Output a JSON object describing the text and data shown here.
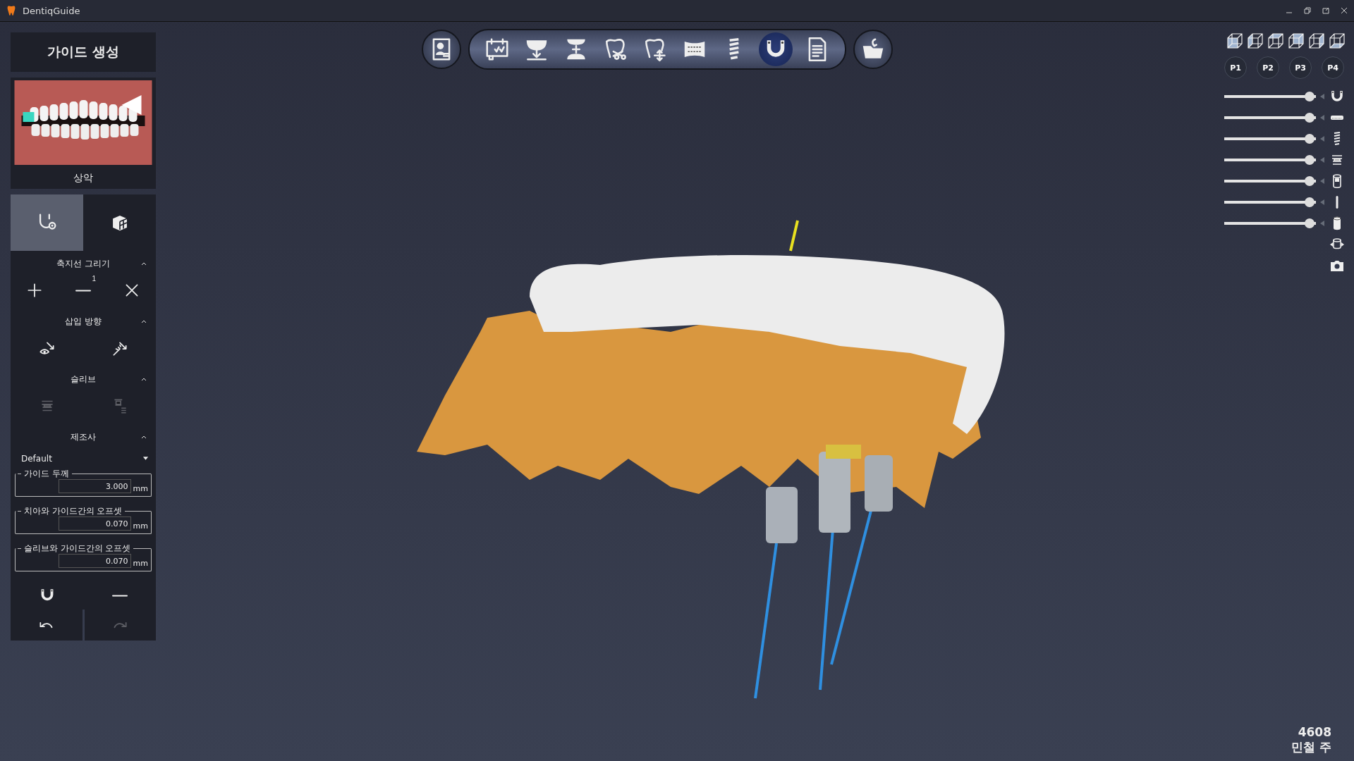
{
  "window": {
    "title": "DentiqGuide"
  },
  "panel": {
    "title": "가이드 생성",
    "arch_label": "상악"
  },
  "mode_tabs": [
    {
      "kind": "guide",
      "selected": true
    },
    {
      "kind": "model",
      "selected": false
    }
  ],
  "sections": [
    {
      "title": "축지선 그리기",
      "expanded": true,
      "tools": [
        {
          "kind": "plus",
          "disabled": false
        },
        {
          "kind": "minus",
          "disabled": false,
          "count": "1"
        },
        {
          "kind": "close",
          "disabled": false
        }
      ]
    },
    {
      "title": "삽입 방향",
      "expanded": true,
      "tools": [
        {
          "kind": "eye-arrow",
          "disabled": false
        },
        {
          "kind": "wand-arrow",
          "disabled": false
        }
      ]
    },
    {
      "title": "슬리브",
      "expanded": true,
      "tools": [
        {
          "kind": "sleeve",
          "disabled": true
        },
        {
          "kind": "sleeve-offset",
          "disabled": true
        }
      ]
    },
    {
      "title": "제조사",
      "expanded": true
    }
  ],
  "manufacturer": {
    "value": "Default"
  },
  "fields": [
    {
      "label": "가이드 두께",
      "value": "3.000",
      "unit": "mm"
    },
    {
      "label": "치아와 가이드간의 오프셋",
      "value": "0.070",
      "unit": "mm"
    },
    {
      "label": "슬리브와 가이드간의 오프셋",
      "value": "0.070",
      "unit": "mm"
    }
  ],
  "bottom_tools": [
    {
      "kind": "guide"
    },
    {
      "kind": "minus"
    }
  ],
  "history": [
    {
      "kind": "undo",
      "disabled": false
    },
    {
      "kind": "redo",
      "disabled": true
    }
  ],
  "toolbar": {
    "left": {
      "kind": "patient"
    },
    "items": [
      {
        "kind": "plan",
        "selected": false
      },
      {
        "kind": "import",
        "selected": false
      },
      {
        "kind": "jaws",
        "selected": false
      },
      {
        "kind": "cut",
        "selected": false
      },
      {
        "kind": "move",
        "selected": false
      },
      {
        "kind": "panorama",
        "selected": false
      },
      {
        "kind": "implant",
        "selected": false
      },
      {
        "kind": "guide",
        "selected": true
      },
      {
        "kind": "report",
        "selected": false
      }
    ],
    "right": {
      "kind": "folder"
    }
  },
  "view_buttons": [
    {
      "kind": "front"
    },
    {
      "kind": "left"
    },
    {
      "kind": "top"
    },
    {
      "kind": "back"
    },
    {
      "kind": "right"
    },
    {
      "kind": "bottom"
    }
  ],
  "presets": [
    "P1",
    "P2",
    "P3",
    "P4"
  ],
  "layers": [
    {
      "kind": "guide",
      "level": 0.98
    },
    {
      "kind": "teeth",
      "level": 0.98
    },
    {
      "kind": "implant",
      "level": 0.98
    },
    {
      "kind": "sleeve",
      "level": 0.98
    },
    {
      "kind": "cylinder",
      "level": 0.98
    },
    {
      "kind": "pin",
      "level": 0.98
    },
    {
      "kind": "solid",
      "level": 0.98
    }
  ],
  "extra_tools": [
    {
      "kind": "rotate"
    },
    {
      "kind": "camera"
    }
  ],
  "footer": {
    "id": "4608",
    "name": "민철 주"
  }
}
